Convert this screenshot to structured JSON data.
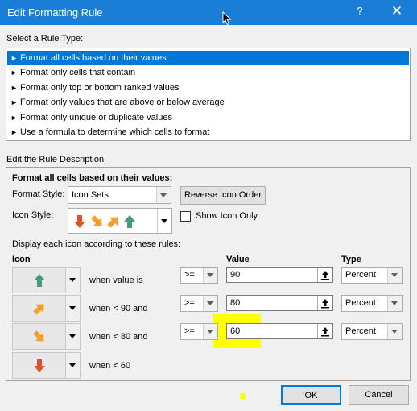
{
  "window": {
    "title": "Edit Formatting Rule",
    "help_glyph": "?",
    "close_glyph": "✕"
  },
  "rule_type": {
    "label": "Select a Rule Type:",
    "items": [
      {
        "label": "Format all cells based on their values",
        "selected": true
      },
      {
        "label": "Format only cells that contain",
        "selected": false
      },
      {
        "label": "Format only top or bottom ranked values",
        "selected": false
      },
      {
        "label": "Format only values that are above or below average",
        "selected": false
      },
      {
        "label": "Format only unique or duplicate values",
        "selected": false
      },
      {
        "label": "Use a formula to determine which cells to format",
        "selected": false
      }
    ]
  },
  "description": {
    "label": "Edit the Rule Description:",
    "heading": "Format all cells based on their values:",
    "format_style_label": "Format Style:",
    "format_style_value": "Icon Sets",
    "reverse_button": "Reverse Icon Order",
    "icon_style_label": "Icon Style:",
    "show_icon_only_label": "Show Icon Only",
    "show_icon_only_checked": false,
    "rules_caption": "Display each icon according to these rules:",
    "col_icon": "Icon",
    "col_value": "Value",
    "col_type": "Type",
    "rows": [
      {
        "icon": "arrow-up-green-icon",
        "when": "when value is",
        "operator": ">=",
        "value": "90",
        "type": "Percent"
      },
      {
        "icon": "arrow-up-right-orange-icon",
        "when": "when < 90 and",
        "operator": ">=",
        "value": "80",
        "type": "Percent"
      },
      {
        "icon": "arrow-down-right-orange-icon",
        "when": "when < 80 and",
        "operator": ">=",
        "value": "60",
        "type": "Percent"
      },
      {
        "icon": "arrow-down-red-icon",
        "when": "when < 60"
      }
    ]
  },
  "buttons": {
    "ok": "OK",
    "cancel": "Cancel"
  },
  "colors": {
    "titlebar": "#1a7ed6",
    "selection": "#0078d7",
    "highlight": "#ffff00",
    "arrow_green": "#4a9a7c",
    "arrow_orange": "#f0a030",
    "arrow_red": "#d9542c"
  }
}
